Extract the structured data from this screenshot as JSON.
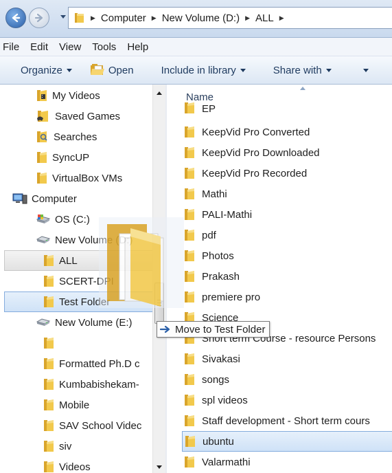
{
  "address_bar": {
    "crumbs": [
      "Computer",
      "New Volume (D:)",
      "ALL"
    ]
  },
  "menu": [
    "File",
    "Edit",
    "View",
    "Tools",
    "Help"
  ],
  "toolbar": {
    "organize": "Organize",
    "open": "Open",
    "include": "Include in library",
    "share": "Share with"
  },
  "nav_pane": [
    {
      "label": "My Videos",
      "icon": "videos-folder-icon"
    },
    {
      "label": "Saved Games",
      "icon": "saved-games-icon"
    },
    {
      "label": "Searches",
      "icon": "searches-icon"
    },
    {
      "label": "SyncUP",
      "icon": "folder-icon"
    },
    {
      "label": "VirtualBox VMs",
      "icon": "folder-icon"
    },
    {
      "label": "Computer",
      "icon": "computer-icon"
    },
    {
      "label": "OS (C:)",
      "icon": "os-drive-icon"
    },
    {
      "label": "New Volume (D:)",
      "icon": "drive-icon"
    },
    {
      "label": "ALL",
      "icon": "folder-icon"
    },
    {
      "label": "SCERT-DPI",
      "icon": "folder-icon"
    },
    {
      "label": "Test Folder",
      "icon": "folder-icon"
    },
    {
      "label": "New Volume (E:)",
      "icon": "drive-icon"
    },
    {
      "label": "",
      "icon": "folder-icon"
    },
    {
      "label": "Formatted Ph.D c",
      "icon": "folder-icon"
    },
    {
      "label": "Kumbabishekam-",
      "icon": "folder-icon"
    },
    {
      "label": "Mobile",
      "icon": "folder-icon"
    },
    {
      "label": "SAV School Videc",
      "icon": "folder-icon"
    },
    {
      "label": "siv",
      "icon": "folder-icon"
    },
    {
      "label": "Videos",
      "icon": "folder-icon"
    }
  ],
  "file_pane": {
    "column_header": "Name",
    "items": [
      "EP",
      "KeepVid Pro Converted",
      "KeepVid Pro Downloaded",
      "KeepVid Pro Recorded",
      "Mathi",
      "PALI-Mathi",
      "pdf",
      "Photos",
      "Prakash",
      "premiere pro",
      "Science",
      "Short term Course - resource Persons",
      "Sivakasi",
      "songs",
      "spl videos",
      "Staff development - Short term cours",
      "ubuntu",
      "Valarmathi"
    ]
  },
  "drag_tooltip": "Move to Test Folder",
  "colors": {
    "folder": "#f2c94c",
    "selection": "#cfe2f7",
    "selection_border": "#84acdd"
  }
}
